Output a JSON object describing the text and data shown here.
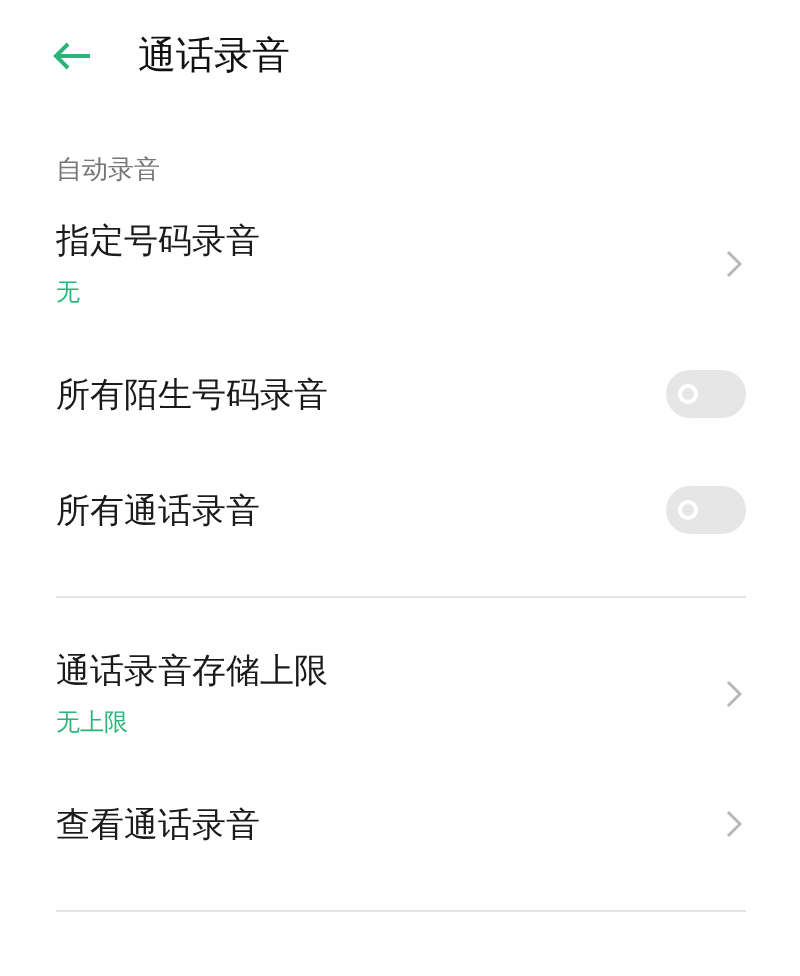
{
  "header": {
    "title": "通话录音"
  },
  "groups": [
    {
      "title": "自动录音",
      "items": [
        {
          "kind": "link",
          "label": "指定号码录音",
          "value": "无"
        },
        {
          "kind": "toggle",
          "label": "所有陌生号码录音",
          "on": false
        },
        {
          "kind": "toggle",
          "label": "所有通话录音",
          "on": false
        }
      ]
    },
    {
      "items": [
        {
          "kind": "link",
          "label": "通话录音存储上限",
          "value": "无上限"
        },
        {
          "kind": "link",
          "label": "查看通话录音"
        }
      ]
    }
  ]
}
